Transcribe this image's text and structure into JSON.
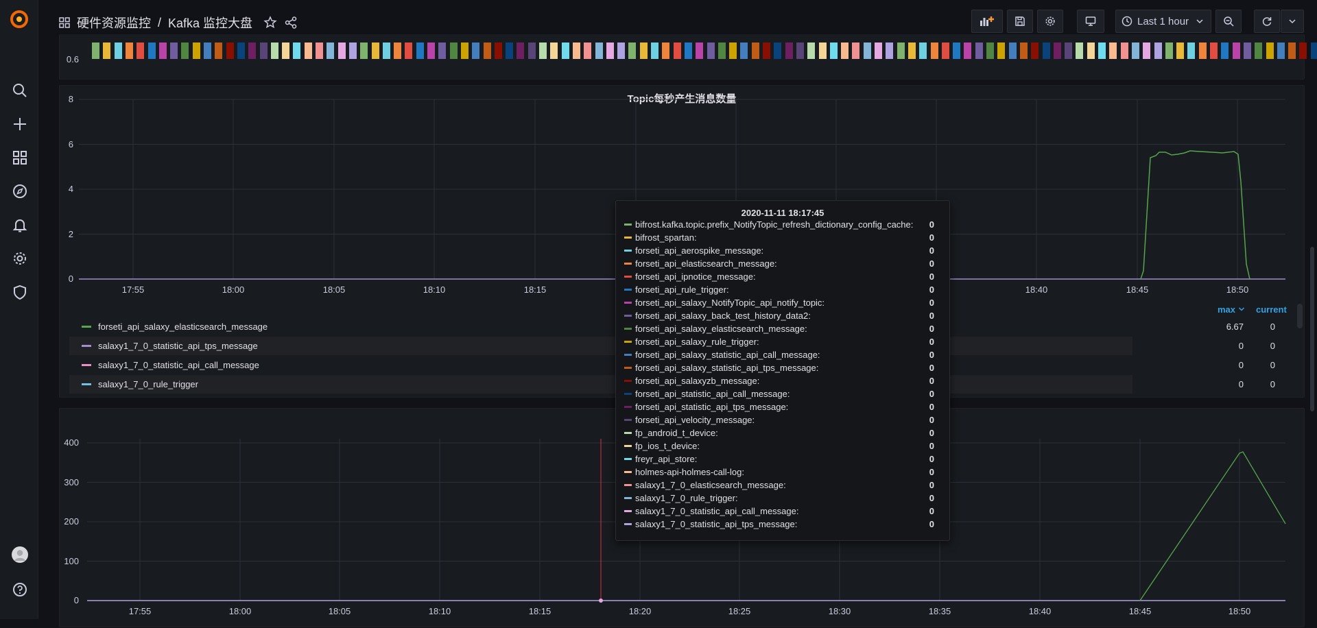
{
  "breadcrumb": {
    "folder": "硬件资源监控",
    "separator": "/",
    "dashboard": "Kafka 监控大盘"
  },
  "toolbar": {
    "time_range": "Last 1 hour"
  },
  "top_strip": {
    "ytick": "0.6"
  },
  "panel1": {
    "title": "Topic每秒产生消息数量",
    "yticks": [
      "8",
      "6",
      "4",
      "2",
      "0"
    ],
    "xticks": [
      "17:55",
      "18:00",
      "18:05",
      "18:10",
      "18:15",
      "18:40",
      "18:45",
      "18:50"
    ],
    "legend_headers": {
      "max": "max",
      "current": "current"
    },
    "legend": [
      {
        "name": "forseti_api_salaxy_elasticsearch_message",
        "color": "#56a64b",
        "max": "6.67",
        "current": "0"
      },
      {
        "name": "salaxy1_7_0_statistic_api_tps_message",
        "color": "#a18fcf",
        "max": "0",
        "current": "0"
      },
      {
        "name": "salaxy1_7_0_statistic_api_call_message",
        "color": "#e98fc2",
        "max": "0",
        "current": "0"
      },
      {
        "name": "salaxy1_7_0_rule_trigger",
        "color": "#73bfe6",
        "max": "0",
        "current": "0"
      }
    ]
  },
  "panel2": {
    "yticks": [
      "400",
      "300",
      "200",
      "100",
      "0"
    ],
    "xticks": [
      "17:55",
      "18:00",
      "18:05",
      "18:10",
      "18:15",
      "18:20",
      "18:25",
      "18:30",
      "18:35",
      "18:40",
      "18:45",
      "18:50"
    ]
  },
  "tooltip": {
    "time": "2020-11-11 18:17:45",
    "rows": [
      {
        "label": "bifrost.kafka.topic.prefix_NotifyTopic_refresh_dictionary_config_cache:",
        "value": "0",
        "color": "#7eb26d"
      },
      {
        "label": "bifrost_spartan:",
        "value": "0",
        "color": "#eab839"
      },
      {
        "label": "forseti_api_aerospike_message:",
        "value": "0",
        "color": "#6ed0e0"
      },
      {
        "label": "forseti_api_elasticsearch_message:",
        "value": "0",
        "color": "#ef843c"
      },
      {
        "label": "forseti_api_ipnotice_message:",
        "value": "0",
        "color": "#e24d42"
      },
      {
        "label": "forseti_api_rule_trigger:",
        "value": "0",
        "color": "#1f78c1"
      },
      {
        "label": "forseti_api_salaxy_NotifyTopic_api_notify_topic:",
        "value": "0",
        "color": "#ba43a9"
      },
      {
        "label": "forseti_api_salaxy_back_test_history_data2:",
        "value": "0",
        "color": "#705da0"
      },
      {
        "label": "forseti_api_salaxy_elasticsearch_message:",
        "value": "0",
        "color": "#508642"
      },
      {
        "label": "forseti_api_salaxy_rule_trigger:",
        "value": "0",
        "color": "#cca300"
      },
      {
        "label": "forseti_api_salaxy_statistic_api_call_message:",
        "value": "0",
        "color": "#447ebc"
      },
      {
        "label": "forseti_api_salaxy_statistic_api_tps_message:",
        "value": "0",
        "color": "#c15c17"
      },
      {
        "label": "forseti_api_salaxyzb_message:",
        "value": "0",
        "color": "#890f02"
      },
      {
        "label": "forseti_api_statistic_api_call_message:",
        "value": "0",
        "color": "#0a437c"
      },
      {
        "label": "forseti_api_statistic_api_tps_message:",
        "value": "0",
        "color": "#6d1f62"
      },
      {
        "label": "forseti_api_velocity_message:",
        "value": "0",
        "color": "#584477"
      },
      {
        "label": "fp_android_t_device:",
        "value": "0",
        "color": "#b7dbab"
      },
      {
        "label": "fp_ios_t_device:",
        "value": "0",
        "color": "#f4d598"
      },
      {
        "label": "freyr_api_store:",
        "value": "0",
        "color": "#70dbed"
      },
      {
        "label": "holmes-api-holmes-call-log:",
        "value": "0",
        "color": "#f9ba8f"
      },
      {
        "label": "salaxy1_7_0_elasticsearch_message:",
        "value": "0",
        "color": "#f29191"
      },
      {
        "label": "salaxy1_7_0_rule_trigger:",
        "value": "0",
        "color": "#82b5d8"
      },
      {
        "label": "salaxy1_7_0_statistic_api_call_message:",
        "value": "0",
        "color": "#e5a8e2"
      },
      {
        "label": "salaxy1_7_0_statistic_api_tps_message:",
        "value": "0",
        "color": "#aea2e0"
      }
    ]
  },
  "colors": {
    "accent_blue": "#33a2e5",
    "series_green": "#56a64b",
    "cursor_red": "#e02f44"
  }
}
